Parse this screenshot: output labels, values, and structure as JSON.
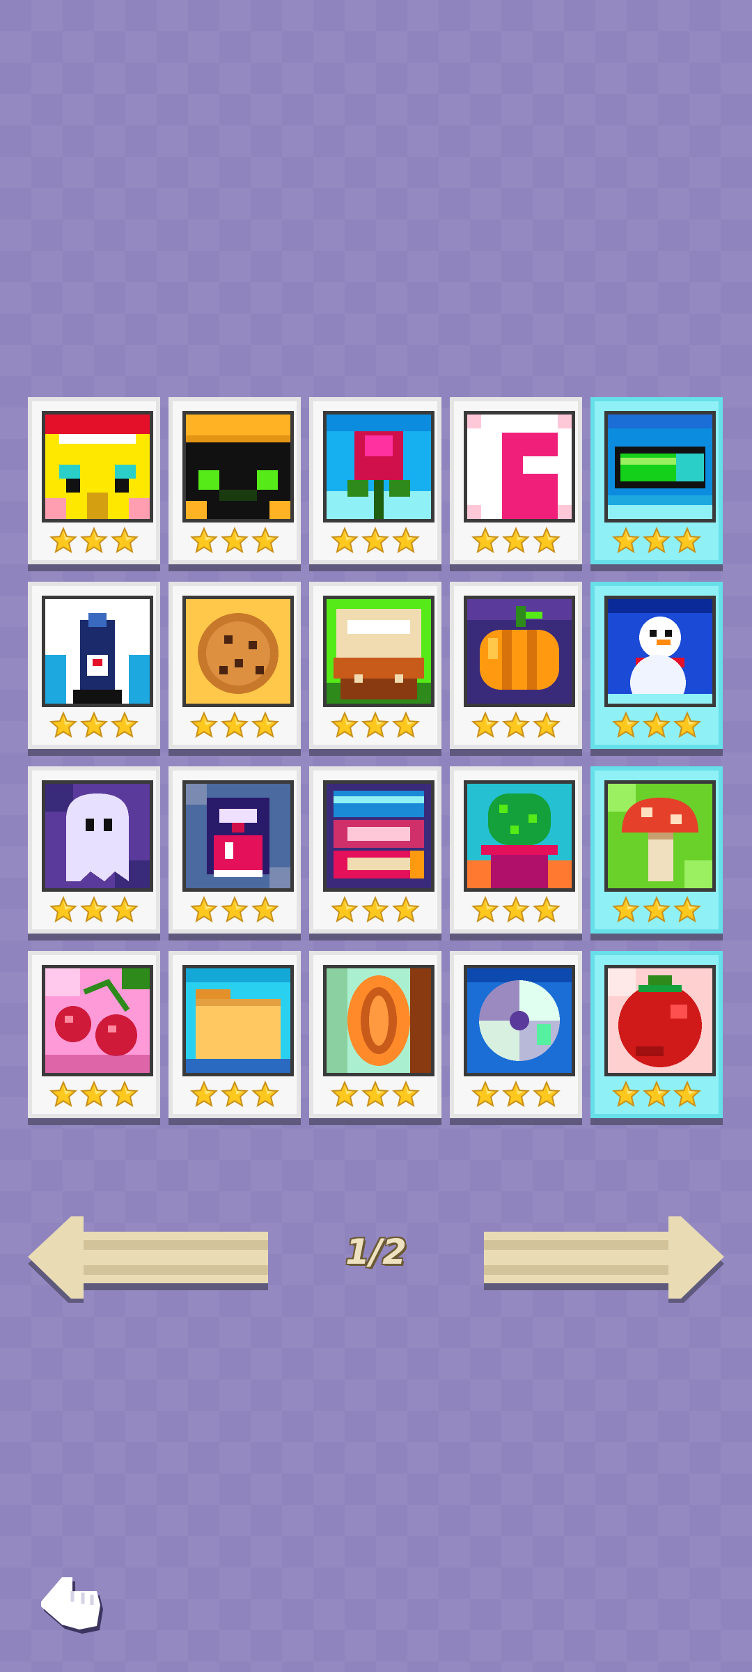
{
  "header": {
    "level_select_pages": ""
  },
  "levels": [
    {
      "icon": "pixel-face-icon",
      "stars": 3,
      "special": false
    },
    {
      "icon": "pixel-frog-icon",
      "stars": 3,
      "special": false
    },
    {
      "icon": "pixel-rose-icon",
      "stars": 3,
      "special": false
    },
    {
      "icon": "pixel-pink-frame-icon",
      "stars": 3,
      "special": false
    },
    {
      "icon": "pixel-battery-icon",
      "stars": 3,
      "special": true
    },
    {
      "icon": "pixel-penguin-icon",
      "stars": 3,
      "special": false
    },
    {
      "icon": "pixel-cookie-icon",
      "stars": 3,
      "special": false
    },
    {
      "icon": "pixel-burger-icon",
      "stars": 3,
      "special": false
    },
    {
      "icon": "pixel-pumpkin-icon",
      "stars": 3,
      "special": false
    },
    {
      "icon": "pixel-snowman-icon",
      "stars": 3,
      "special": true
    },
    {
      "icon": "pixel-ghost-icon",
      "stars": 3,
      "special": false
    },
    {
      "icon": "pixel-potion-icon",
      "stars": 3,
      "special": false
    },
    {
      "icon": "pixel-books-icon",
      "stars": 3,
      "special": false
    },
    {
      "icon": "pixel-cactus-icon",
      "stars": 3,
      "special": false
    },
    {
      "icon": "pixel-mushroom-icon",
      "stars": 3,
      "special": true
    },
    {
      "icon": "pixel-cherries-icon",
      "stars": 3,
      "special": false
    },
    {
      "icon": "pixel-folder-icon",
      "stars": 3,
      "special": false
    },
    {
      "icon": "pixel-coin-icon",
      "stars": 3,
      "special": false
    },
    {
      "icon": "pixel-disc-icon",
      "stars": 3,
      "special": false
    },
    {
      "icon": "pixel-tomato-icon",
      "stars": 3,
      "special": true
    }
  ],
  "pagination": {
    "label": "1/2"
  },
  "colors": {
    "background": "#9084be",
    "card": "#f7f7f7",
    "card_special": "#8ff0f5",
    "star": "#ffc81e",
    "arrow": "#e9dcb5"
  }
}
